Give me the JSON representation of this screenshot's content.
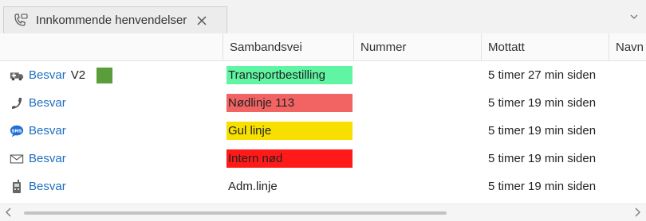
{
  "tab": {
    "title": "Innkommende henvendelser",
    "icon": "phone-chat-icon",
    "close_icon": "close-icon"
  },
  "columns": [
    "",
    "Sambandsvei",
    "Nummer",
    "Mottatt",
    "Navn"
  ],
  "rows": [
    {
      "icon": "ambulance-icon",
      "action": "Besvar",
      "suffix": "V2",
      "swatch_color": "#5a9e3c",
      "channel": "Transportbestilling",
      "channel_color": "#5ff5a2",
      "number": "",
      "received": "5 timer 27 min siden"
    },
    {
      "icon": "phone-icon",
      "action": "Besvar",
      "suffix": "",
      "swatch_color": "",
      "channel": "Nødlinje 113",
      "channel_color": "#f26464",
      "number": "",
      "received": "5 timer 19 min siden"
    },
    {
      "icon": "sms-icon",
      "action": "Besvar",
      "suffix": "",
      "swatch_color": "",
      "channel": "Gul linje",
      "channel_color": "#f7e000",
      "number": "",
      "received": "5 timer 19 min siden"
    },
    {
      "icon": "envelope-icon",
      "action": "Besvar",
      "suffix": "",
      "swatch_color": "",
      "channel": "Intern nød",
      "channel_color": "#ff1a1a",
      "number": "",
      "received": "5 timer 19 min siden"
    },
    {
      "icon": "radio-icon",
      "action": "Besvar",
      "suffix": "",
      "swatch_color": "",
      "channel": "Adm.linje",
      "channel_color": "",
      "number": "",
      "received": "5 timer 19 min siden"
    }
  ]
}
